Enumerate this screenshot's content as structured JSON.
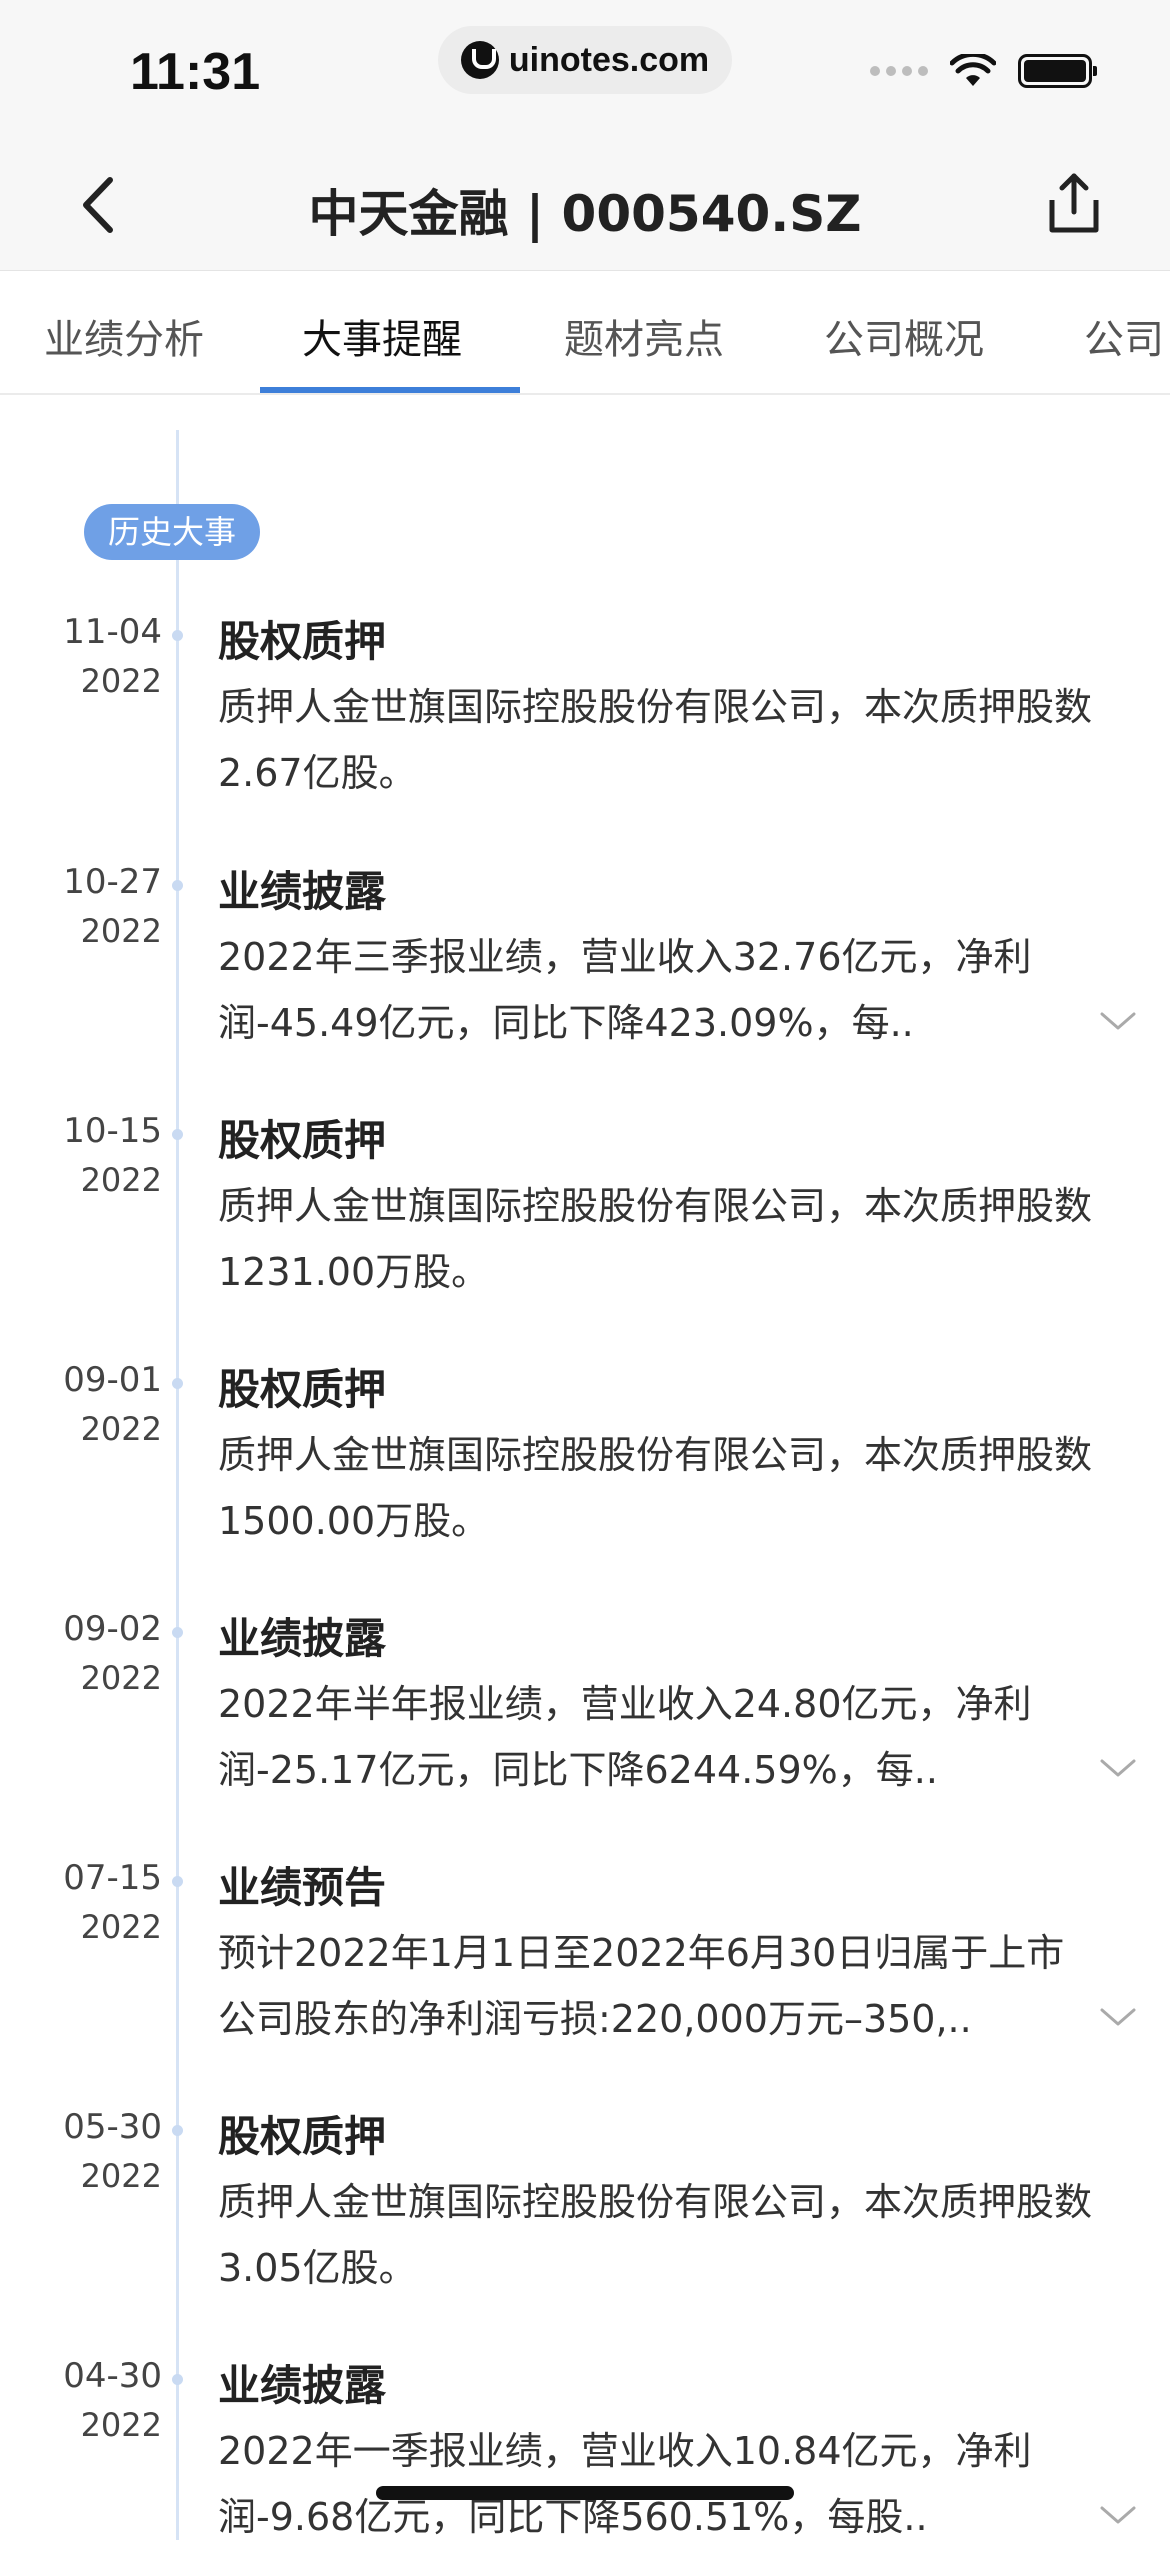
{
  "status_bar": {
    "time": "11:31",
    "url": "uinotes.com"
  },
  "nav": {
    "title": "中天金融 | 000540.SZ"
  },
  "tabs": [
    {
      "label": "业绩分析",
      "active": false
    },
    {
      "label": "大事提醒",
      "active": true
    },
    {
      "label": "题材亮点",
      "active": false
    },
    {
      "label": "公司概况",
      "active": false
    },
    {
      "label": "公司",
      "active": false
    }
  ],
  "timeline": {
    "section_label": "历史大事",
    "events": [
      {
        "date": "11-04",
        "year": "2022",
        "title": "股权质押",
        "desc": "质押人金世旗国际控股股份有限公司，本次质押股数2.67亿股。",
        "expandable": false
      },
      {
        "date": "10-27",
        "year": "2022",
        "title": "业绩披露",
        "desc": "2022年三季报业绩，营业收入32.76亿元，净利润-45.49亿元，同比下降423.09%，每..",
        "expandable": true
      },
      {
        "date": "10-15",
        "year": "2022",
        "title": "股权质押",
        "desc": "质押人金世旗国际控股股份有限公司，本次质押股数1231.00万股。",
        "expandable": false
      },
      {
        "date": "09-01",
        "year": "2022",
        "title": "股权质押",
        "desc": "质押人金世旗国际控股股份有限公司，本次质押股数1500.00万股。",
        "expandable": false
      },
      {
        "date": "09-02",
        "year": "2022",
        "title": "业绩披露",
        "desc": "2022年半年报业绩，营业收入24.80亿元，净利润-25.17亿元，同比下降6244.59%，每..",
        "expandable": true
      },
      {
        "date": "07-15",
        "year": "2022",
        "title": "业绩预告",
        "desc": "预计2022年1月1日至2022年6月30日归属于上市公司股东的净利润亏损:220,000万元–350,..",
        "expandable": true
      },
      {
        "date": "05-30",
        "year": "2022",
        "title": "股权质押",
        "desc": "质押人金世旗国际控股股份有限公司，本次质押股数3.05亿股。",
        "expandable": false
      },
      {
        "date": "04-30",
        "year": "2022",
        "title": "业绩披露",
        "desc": "2022年一季报业绩，营业收入10.84亿元，净利润-9.68亿元，同比下降560.51%，每股..",
        "expandable": true
      }
    ]
  },
  "colors": {
    "accent": "#3d7fd9",
    "badge": "#6fa0e6",
    "timeline": "#d6e3f5"
  }
}
